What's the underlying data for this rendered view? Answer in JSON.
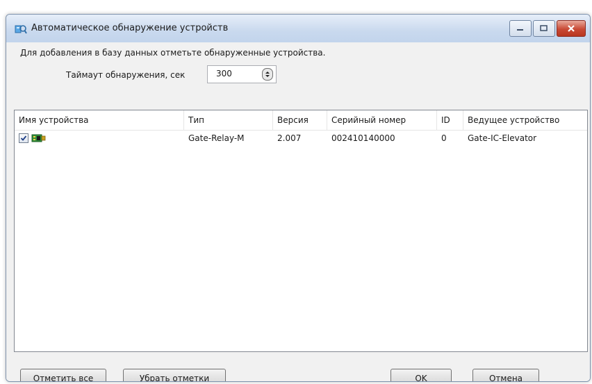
{
  "window": {
    "title": "Автоматическое обнаружение устройств"
  },
  "form": {
    "instruction": "Для добавления в базу данных отметьте обнаруженные устройства.",
    "timeout_label": "Таймаут обнаружения, сек",
    "timeout_value": "300"
  },
  "table": {
    "columns": [
      "Имя устройства",
      "Тип",
      "Версия",
      "Серийный номер",
      "ID",
      "Ведущее устройство"
    ],
    "rows": [
      {
        "checked": true,
        "icon": "device-board-icon",
        "name": "",
        "type": "Gate-Relay-M",
        "version": "2.007",
        "serial": "002410140000",
        "id": "0",
        "master": "Gate-IC-Elevator"
      }
    ]
  },
  "buttons": {
    "check_all": "Отметить все",
    "uncheck_all": "Убрать отметки",
    "ok": "OK",
    "cancel": "Отмена"
  },
  "colors": {
    "window_frame": "#7f93ad",
    "titlebar": "#c9d9ee",
    "close_button": "#c94a35",
    "dialog_bg": "#f1f1f1"
  }
}
